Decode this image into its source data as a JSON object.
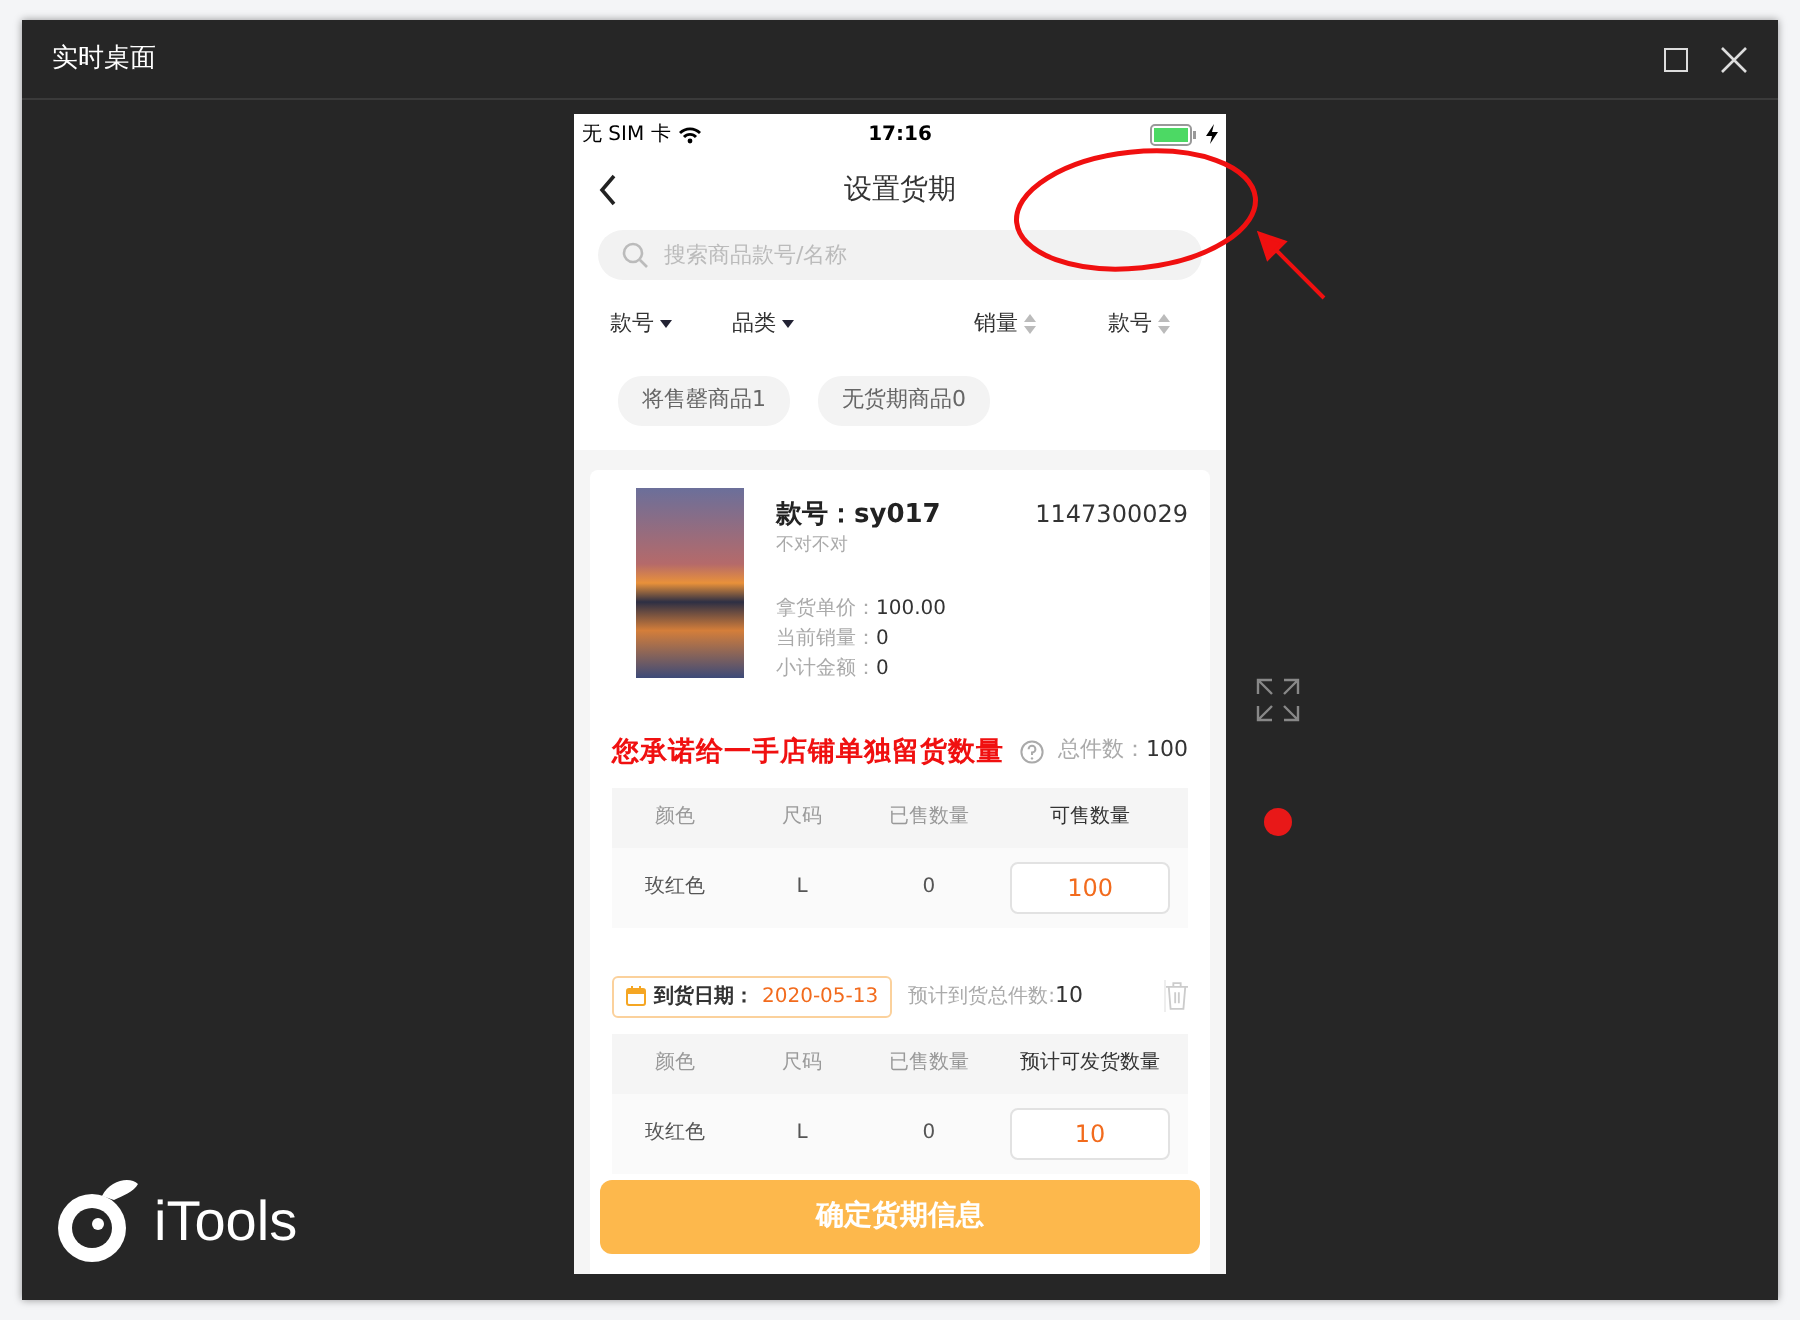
{
  "window": {
    "title": "实时桌面"
  },
  "phone": {
    "status_bar": {
      "carrier": "无 SIM 卡",
      "time": "17:16"
    },
    "nav": {
      "title": "设置货期"
    },
    "search": {
      "placeholder": "搜索商品款号/名称"
    },
    "filters": [
      {
        "label": "款号",
        "kind": "dropdown"
      },
      {
        "label": "品类",
        "kind": "dropdown"
      },
      {
        "label": "销量",
        "kind": "sort"
      },
      {
        "label": "款号",
        "kind": "sort"
      }
    ],
    "chips": [
      "将售罄商品1",
      "无货期商品0"
    ],
    "product": {
      "style": "款号：sy017",
      "subtitle": "不对不对",
      "code": "1147300029",
      "details": [
        {
          "label": "拿货单价：",
          "value": "100.00"
        },
        {
          "label": "当前销量：",
          "value": "0"
        },
        {
          "label": "小计金额：",
          "value": "0"
        }
      ]
    },
    "commitment": {
      "title": "您承诺给一手店铺单独留货数量",
      "total_label": "总件数：",
      "total": "100"
    },
    "stock_table": {
      "columns": [
        {
          "label": "颜色",
          "emphasized": false
        },
        {
          "label": "尺码",
          "emphasized": false
        },
        {
          "label": "已售数量",
          "emphasized": false
        },
        {
          "label": "可售数量",
          "emphasized": true
        }
      ],
      "rows": [
        {
          "shade": "玫红色",
          "size": "L",
          "sold": "0",
          "quantity": "100"
        }
      ]
    },
    "arrivals": [
      {
        "date_label": "到货日期：",
        "date": "2020-05-13",
        "total_label": "预计到货总件数:",
        "total": "10",
        "columns": [
          {
            "label": "颜色",
            "emphasized": false
          },
          {
            "label": "尺码",
            "emphasized": false
          },
          {
            "label": "已售数量",
            "emphasized": false
          },
          {
            "label": "预计可发货数量",
            "emphasized": true
          }
        ],
        "rows": [
          {
            "shade": "玫红色",
            "size": "L",
            "sold": "0",
            "quantity": "10"
          }
        ]
      }
    ],
    "confirm_button": "确定货期信息"
  },
  "recording": {
    "color": "#e81818"
  },
  "logo": {
    "text": "iTools"
  }
}
